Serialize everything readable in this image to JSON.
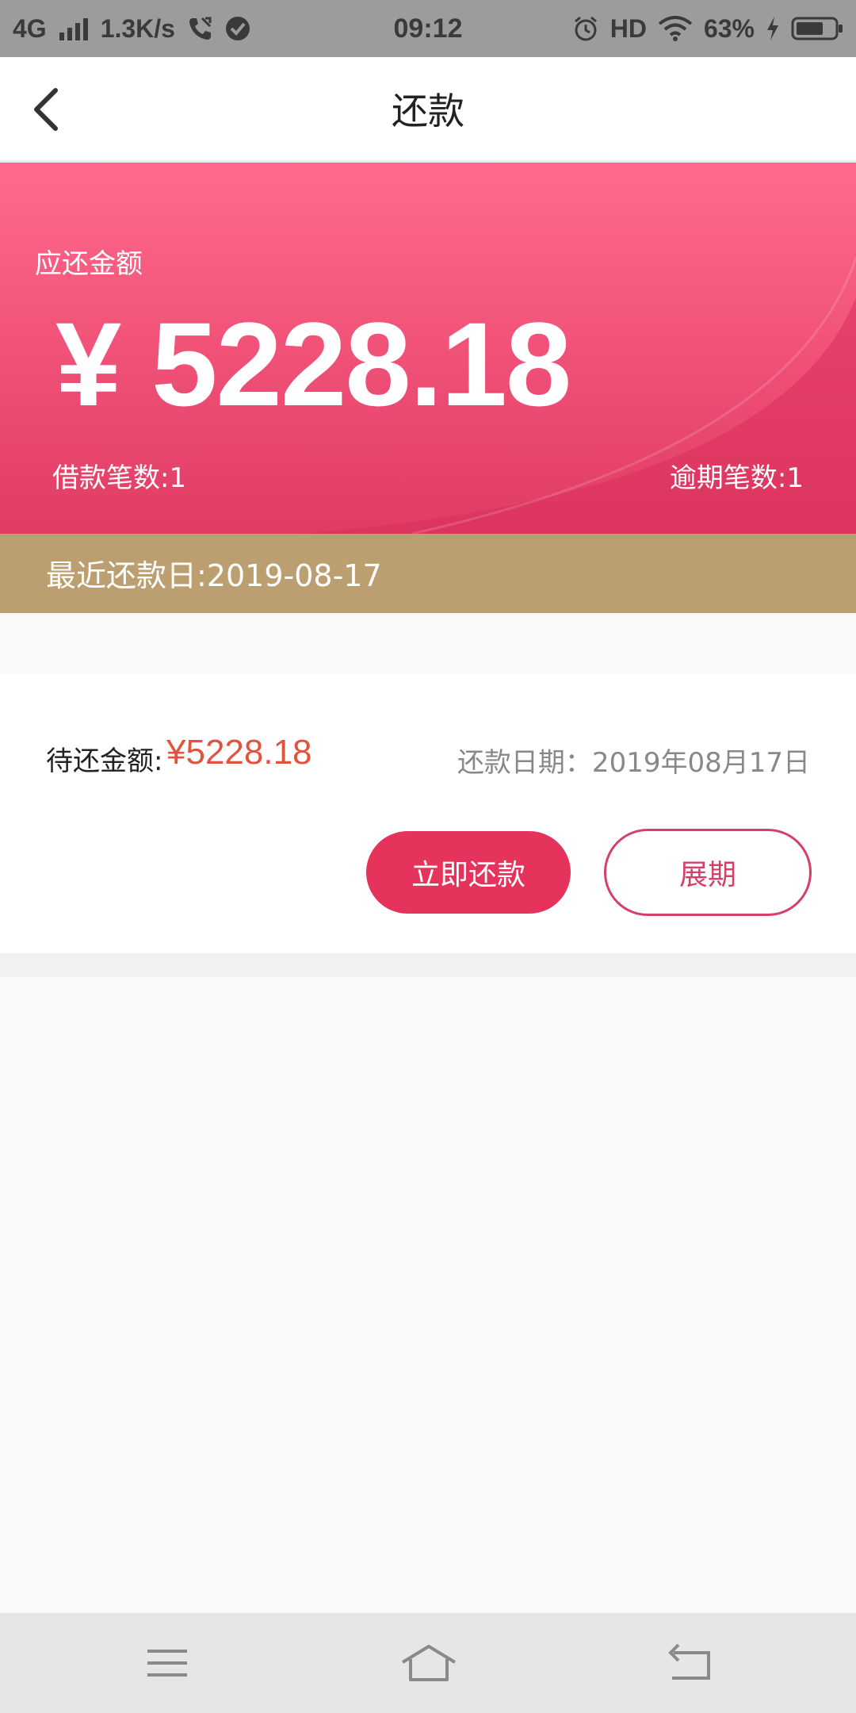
{
  "status_bar": {
    "network": "4G",
    "speed": "1.3K/s",
    "time": "09:12",
    "hd": "HD",
    "battery": "63%"
  },
  "header": {
    "title": "还款"
  },
  "summary": {
    "due_label": "应还金额",
    "due_amount": "¥ 5228.18",
    "loan_count": "借款笔数:1",
    "overdue_count": "逾期笔数:1",
    "recent_date": "最近还款日:2019-08-17",
    "colors": {
      "card": "#f2547a",
      "date_bar": "#bc9f71"
    }
  },
  "repay_item": {
    "pending_label": "待还金额:",
    "pending_amount": "¥5228.18",
    "due_date": "还款日期：2019年08月17日",
    "pay_button": "立即还款",
    "extend_button": "展期",
    "colors": {
      "primary": "#e6335c",
      "amount": "#e0533d"
    }
  },
  "nav": {
    "icons": [
      "menu-icon",
      "home-icon",
      "back-nav-icon"
    ]
  }
}
